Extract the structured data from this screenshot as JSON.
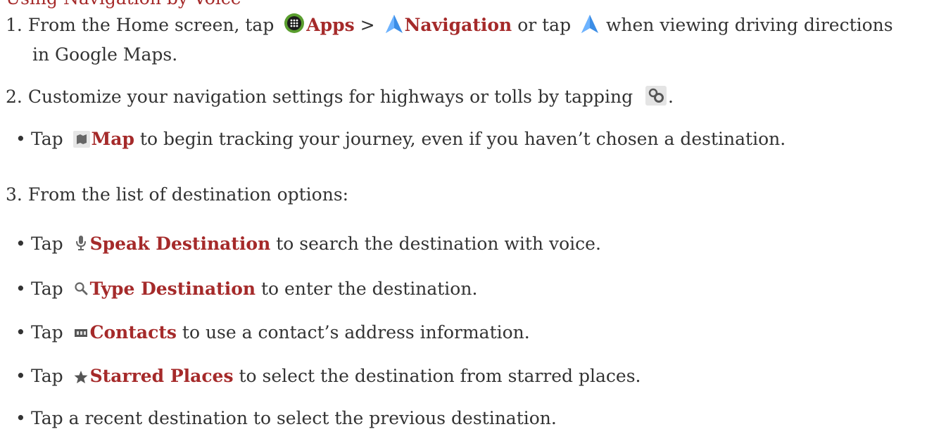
{
  "heading_partial": "Using Navigation by Voice",
  "step1": {
    "number": "1.",
    "pre": "From the Home screen, tap",
    "apps": "Apps",
    "sep": ">",
    "navigation": "Navigation",
    "mid": "or tap",
    "post": "when viewing driving directions",
    "wrap": "in Google Maps."
  },
  "step2": {
    "number": "2.",
    "text": "Customize your navigation settings for highways or tolls by tapping",
    "end": "."
  },
  "map_bullet": {
    "pre": "Tap",
    "link": "Map",
    "post": "to begin tracking your journey, even if you haven’t chosen a destination."
  },
  "step3": {
    "number": "3.",
    "text": "From the list of destination options:"
  },
  "bullets": [
    {
      "pre": "Tap",
      "link": "Speak Destination",
      "post": "to search the destination with voice.",
      "icon": "mic-icon"
    },
    {
      "pre": "Tap",
      "link": "Type Destination",
      "post": "to enter the destination.",
      "icon": "search-icon"
    },
    {
      "pre": "Tap",
      "link": "Contacts",
      "post": "to use a contact’s address information.",
      "icon": "contacts-icon"
    },
    {
      "pre": "Tap",
      "link": "Starred Places",
      "post": "to select the destination from starred places.",
      "icon": "star-icon"
    }
  ],
  "last_bullet": "Tap a recent destination to select the previous destination.",
  "bullet_char": "•",
  "colors": {
    "link": "#a52a2a",
    "text": "#333333"
  }
}
